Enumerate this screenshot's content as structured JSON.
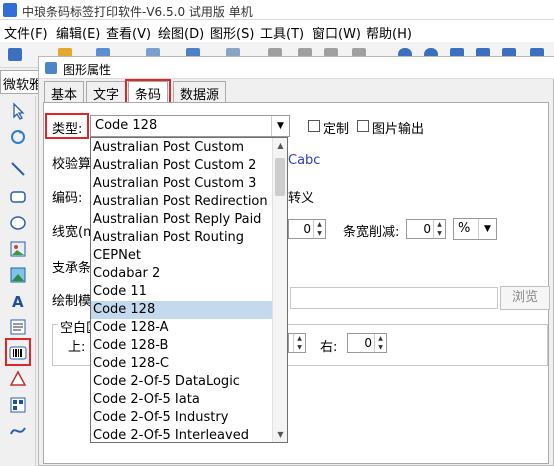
{
  "app": {
    "title": "中琅条码标签打印软件-V6.5.0 试用版 单机"
  },
  "menu": {
    "items": [
      "文件(F)",
      "编辑(E)",
      "查看(V)",
      "绘图(D)",
      "图形(S)",
      "工具(T)",
      "窗口(W)",
      "帮助(H)"
    ]
  },
  "font_box": {
    "value": "微软雅"
  },
  "dialog": {
    "title": "图形属性",
    "tabs": [
      "基本",
      "文字",
      "条码",
      "数据源"
    ],
    "type_label": "类型:",
    "type_value": "Code 128",
    "custom_label": "定制",
    "image_output_label": "图片输出",
    "checksum_label": "校验算",
    "checksum_value": "Cabc",
    "encoding_label": "编码:",
    "escape_label": "转义",
    "linewidth_label": "线宽(m",
    "linewidth_value": "0",
    "bar_reduce_label": "条宽削减:",
    "bar_reduce_value": "0",
    "bar_reduce_unit": "%",
    "support_label": "支承条",
    "draw_mode_label": "绘制模",
    "browse_button": "浏览",
    "quiet_zone_label": "空白区",
    "top_label": "上:",
    "right_label": "右:",
    "right_value": "0"
  },
  "dropdown": {
    "options": [
      "Australian Post Custom",
      "Australian Post Custom 2",
      "Australian Post Custom 3",
      "Australian Post Redirection",
      "Australian Post Reply Paid",
      "Australian Post Routing",
      "CEPNet",
      "Codabar 2",
      "Code 11",
      "Code 128",
      "Code 128-A",
      "Code 128-B",
      "Code 128-C",
      "Code 2-Of-5 DataLogic",
      "Code 2-Of-5 Iata",
      "Code 2-Of-5 Industry",
      "Code 2-Of-5 Interleaved"
    ],
    "selected": "Code 128"
  },
  "colors": {
    "highlight": "#e0262b",
    "selected_row": "#c4d9ee",
    "link_text": "#2a3fbf"
  },
  "icons": [
    "pointer-icon",
    "rotate-icon",
    "line-icon",
    "rectangle-icon",
    "ellipse-icon",
    "image-icon",
    "picture-icon",
    "text-icon",
    "rich-text-icon",
    "barcode-icon",
    "shape-icon",
    "qrcode-icon",
    "curve-icon"
  ]
}
